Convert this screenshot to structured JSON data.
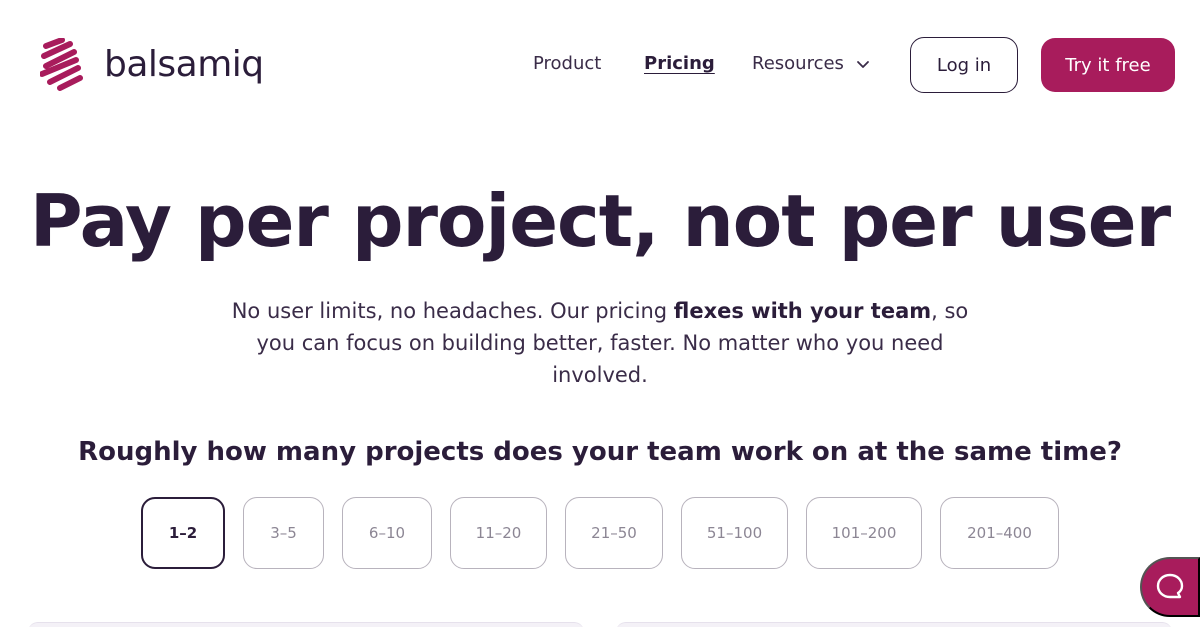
{
  "brand": {
    "name": "balsamiq",
    "accent": "#a81c5c",
    "text_color": "#2b1d3a"
  },
  "nav": {
    "product": "Product",
    "pricing": "Pricing",
    "resources": "Resources",
    "login": "Log in",
    "try_free": "Try it free"
  },
  "hero": {
    "title": "Pay per project, not per user",
    "subtitle_part1": "No user limits, no headaches. Our pricing ",
    "subtitle_bold": "flexes with your team",
    "subtitle_part2": ", so you can focus on building better, faster. No matter who you need involved."
  },
  "projects": {
    "question": "Roughly how many projects does your team work on at the same time?",
    "options": [
      "1–2",
      "3–5",
      "6–10",
      "11–20",
      "21–50",
      "51–100",
      "101–200",
      "201–400"
    ],
    "selected": "1–2"
  },
  "icons": {
    "logo": "balsamiq-scribble-logo",
    "resources_chevron": "chevron-down-icon",
    "chat": "chat-bubble-icon"
  }
}
